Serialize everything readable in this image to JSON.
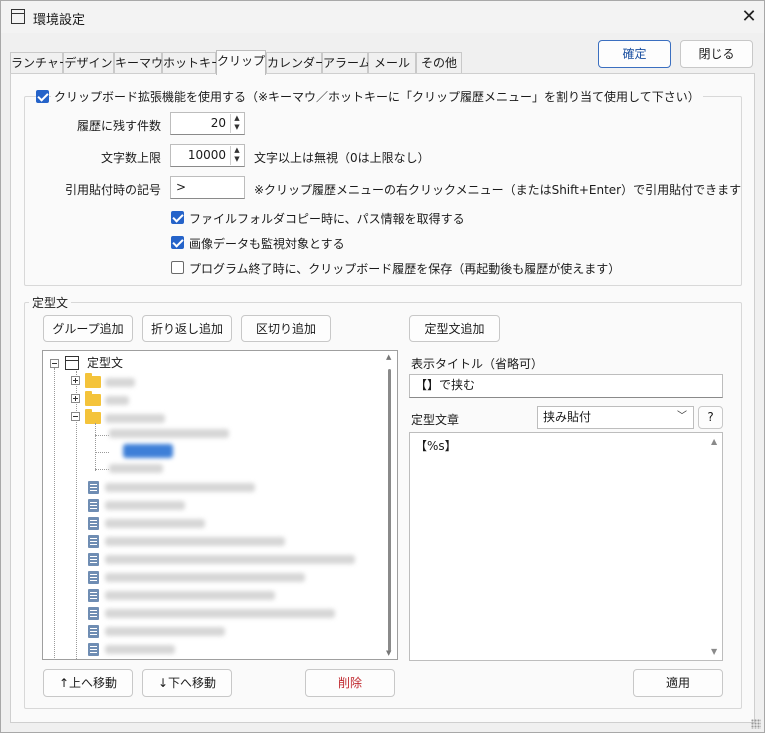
{
  "window": {
    "title": "環境設定"
  },
  "header_buttons": {
    "ok": "確定",
    "close": "閉じる"
  },
  "tabs": [
    "ランチャー",
    "デザイン",
    "キーマウ",
    "ホットキー",
    "クリップ",
    "カレンダー",
    "アラーム",
    "メール",
    "その他"
  ],
  "active_tab": "クリップ",
  "clip": {
    "enable_label": "クリップボード拡張機能を使用する（※キーマウ／ホットキーに「クリップ履歴メニュー」を割り当て使用して下さい）",
    "enable_checked": true,
    "history_label": "履歴に残す件数",
    "history_value": "20",
    "maxchars_label": "文字数上限",
    "maxchars_value": "10000",
    "maxchars_note": "文字以上は無視（0は上限なし）",
    "quote_label": "引用貼付時の記号",
    "quote_value": ">",
    "quote_note": "※クリップ履歴メニューの右クリックメニュー（またはShift+Enter）で引用貼付できます",
    "path_label": "ファイルフォルダコピー時に、パス情報を取得する",
    "path_checked": true,
    "image_label": "画像データも監視対象とする",
    "image_checked": true,
    "save_label": "プログラム終了時に、クリップボード履歴を保存（再起動後も履歴が使えます）",
    "save_checked": false
  },
  "template": {
    "group_label": "定型文",
    "add_group": "グループ追加",
    "add_wrap": "折り返し追加",
    "add_separator": "区切り追加",
    "add_template": "定型文追加",
    "tree_root": "定型文",
    "display_title_label": "表示タイトル（省略可）",
    "display_title_value": "【】で挟む",
    "text_label": "定型文章",
    "mode_value": "挟み貼付",
    "help": "?",
    "text_value": "【%s】",
    "move_up": "↑上へ移動",
    "move_down": "↓下へ移動",
    "delete": "削除",
    "apply": "適用"
  }
}
